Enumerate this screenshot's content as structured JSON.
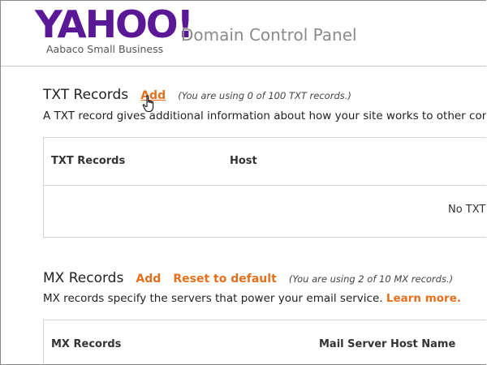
{
  "header": {
    "logo_text": "YAHOO!",
    "logo_subtitle": "Aabaco Small Business",
    "panel_title": "Domain Control Panel"
  },
  "txt_section": {
    "title": "TXT Records",
    "add_label": "Add",
    "usage_note": "(You are using 0 of 100 TXT records.)",
    "description": "A TXT record gives additional information about how your site works to other com",
    "table": {
      "columns": [
        "TXT Records",
        "Host"
      ],
      "empty_message": "No TXT"
    }
  },
  "mx_section": {
    "title": "MX Records",
    "add_label": "Add",
    "reset_label": "Reset to default",
    "usage_note": "(You are using 2 of 10 MX records.)",
    "description": "MX records specify the servers that power your email service.",
    "learn_more": "Learn more.",
    "table": {
      "columns": [
        "MX Records",
        "Mail Server Host Name"
      ]
    }
  },
  "colors": {
    "brand_purple": "#5a1896",
    "link_orange": "#e4701e"
  },
  "icons": {
    "cursor": "hand-pointer-icon"
  }
}
